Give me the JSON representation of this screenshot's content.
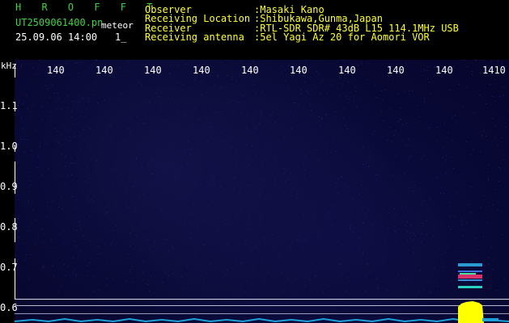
{
  "header": {
    "app_name": "H R O F F T",
    "filename": "UT2509061400.pn",
    "tag": "meteor",
    "datetime": "25.09.06 14:00",
    "count": "1_",
    "fields": [
      {
        "label": "Observer",
        "value": ":Masaki Kano"
      },
      {
        "label": "Receiving Location",
        "value": ":Shibukawa,Gunma,Japan"
      },
      {
        "label": "Receiver",
        "value": ":RTL-SDR SDR# 43dB L15 114.1MHz USB"
      },
      {
        "label": "Receiving antenna",
        "value": ":5el Yagi Az 20 for Aomori VOR"
      }
    ]
  },
  "axis": {
    "unit": "kHz",
    "y_ticks": [
      "1.1",
      "1.0",
      "0.9",
      "0.8",
      "0.7",
      "0.6"
    ],
    "x_ticks": [
      "140",
      "140",
      "140",
      "140",
      "140",
      "140",
      "140",
      "140",
      "140",
      "1410"
    ]
  },
  "colors": {
    "background": "#05052c",
    "header_green": "#41d241",
    "header_yellow": "#ffff33",
    "signal": "#ffff00"
  }
}
